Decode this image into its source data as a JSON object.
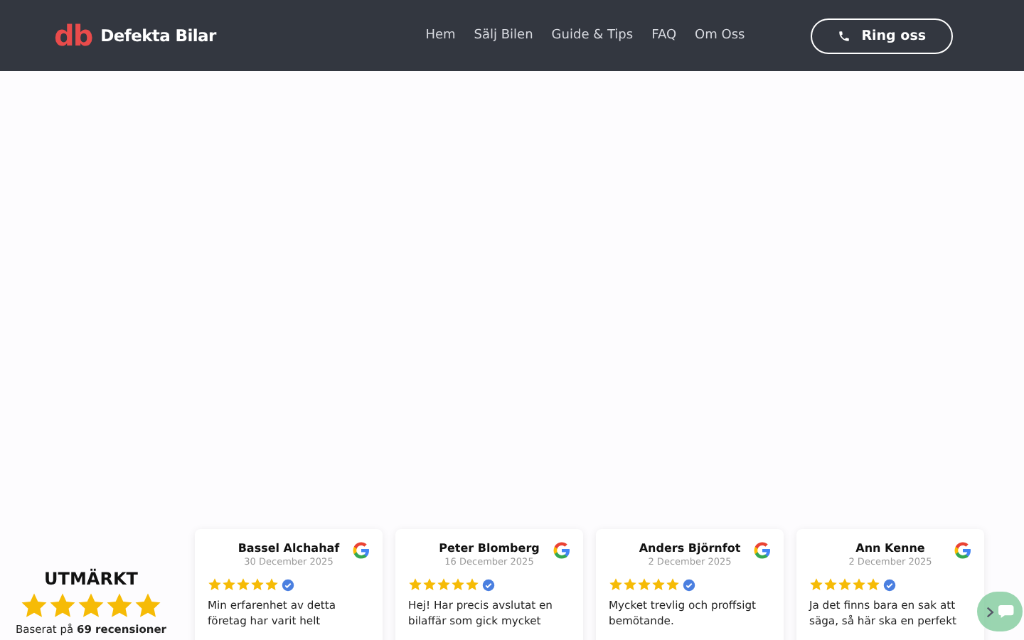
{
  "header": {
    "logo_mark": "db",
    "logo_text": "Defekta Bilar",
    "nav": [
      {
        "label": "Hem"
      },
      {
        "label": "Sälj Bilen"
      },
      {
        "label": "Guide & Tips"
      },
      {
        "label": "FAQ"
      },
      {
        "label": "Om Oss"
      }
    ],
    "call_button": "Ring oss"
  },
  "reviews": {
    "summary": {
      "rating_word": "UTMÄRKT",
      "stars": 5,
      "based_on": "Baserat på **69 recensioner**"
    },
    "items": [
      {
        "name": "Bassel Alchahaf",
        "date": "30 December 2025",
        "stars": 5,
        "verified": true,
        "text": "Min erfarenhet av detta företag har varit helt"
      },
      {
        "name": "Peter Blomberg",
        "date": "16 December 2025",
        "stars": 5,
        "verified": true,
        "text": "Hej! Har precis avslutat en bilaffär som gick mycket"
      },
      {
        "name": "Anders Björnfot",
        "date": "2 December 2025",
        "stars": 5,
        "verified": true,
        "text": "Mycket trevlig och proffsigt bemötande."
      },
      {
        "name": "Ann Kenne",
        "date": "2 December 2025",
        "stars": 5,
        "verified": true,
        "text": "Ja det finns bara en sak att säga, så här ska en perfekt"
      }
    ]
  }
}
